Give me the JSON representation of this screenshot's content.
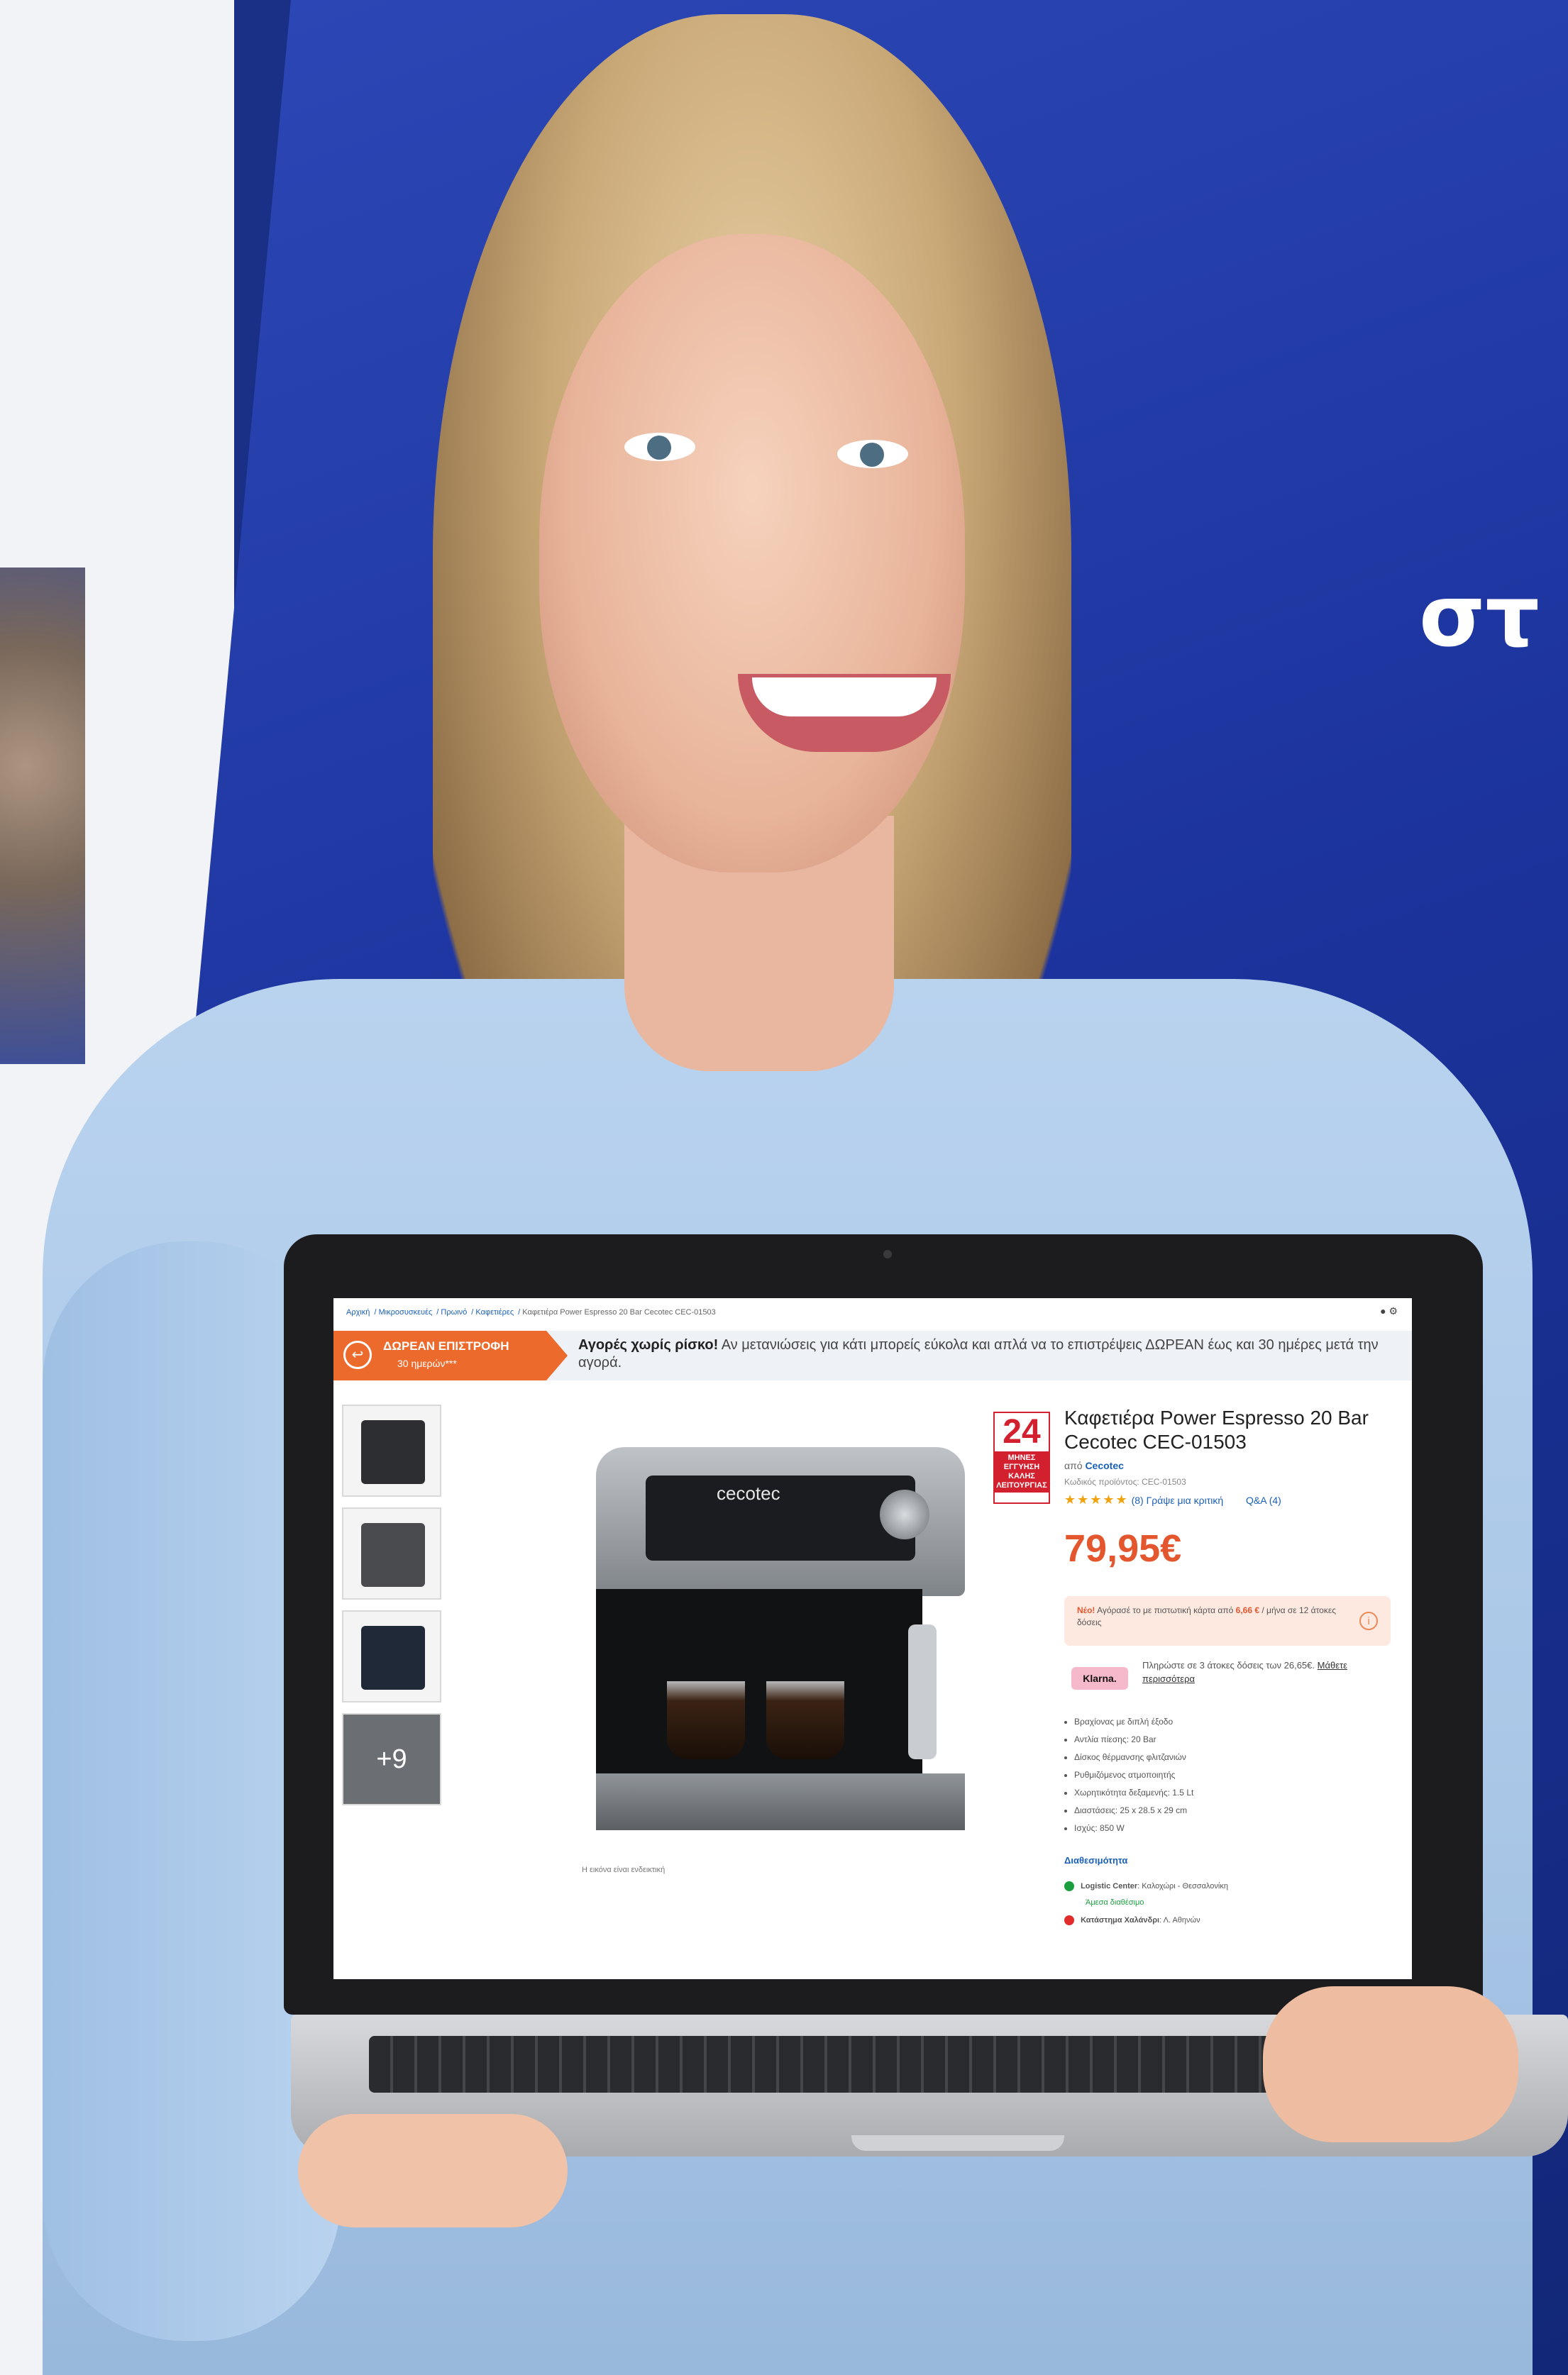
{
  "headline": "στ",
  "screen": {
    "breadcrumb": [
      "Αρχική",
      "Μικροσυσκευές",
      "Πρωινό",
      "Καφετιέρες",
      "Καφετιέρα Power Espresso 20 Bar Cecotec CEC-01503"
    ],
    "promo": {
      "badge_title": "ΔΩΡΕΑΝ ΕΠΙΣΤΡΟΦΗ",
      "badge_sub": "30 ημερών***",
      "bold": "Αγορές χωρίς ρίσκο!",
      "text": "Αν μετανιώσεις για κάτι μπορείς εύκολα και απλά να το επιστρέψεις ΔΩΡΕΑΝ έως και 30 ημέρες μετά την αγορά."
    },
    "gallery": {
      "more_label": "+9",
      "caption": "Η εικόνα είναι ενδεικτική"
    },
    "machine_brand": "cecotec",
    "warranty": {
      "number": "24",
      "text": "ΜΗΝΕΣ ΕΓΓΥΗΣΗ ΚΑΛΗΣ ΛΕΙΤΟΥΡΓΙΑΣ"
    },
    "product": {
      "title": "Καφετιέρα Power Espresso 20 Bar Cecotec CEC-01503",
      "by_prefix": "από",
      "brand": "Cecotec",
      "code_label": "Κωδικός προϊόντος:",
      "code": "CEC-01503",
      "stars": "★★★★★",
      "reviews": "(8) Γράψε μια κριτική",
      "qa": "Q&A (4)",
      "price": "79,95€"
    },
    "credit": {
      "new": "Νέο!",
      "text": "Αγόρασέ το με πιστωτική κάρτα από",
      "amount": "6,66 €",
      "installments": "/ μήνα σε 12 άτοκες δόσεις"
    },
    "klarna": {
      "logo": "Klarna.",
      "text": "Πληρώστε σε 3 άτοκες δόσεις των 26,65€.",
      "link": "Μάθετε περισσότερα"
    },
    "specs": [
      "Βραχίονας με διπλή έξοδο",
      "Αντλία πίεσης: 20 Bar",
      "Δίσκος θέρμανσης φλιτζανιών",
      "Ρυθμιζόμενος ατμοποιητής",
      "Χωρητικότητα δεξαμενής: 1.5 Lt",
      "Διαστάσεις: 25 x 28.5 x 29 cm",
      "Ισχύς: 850 W"
    ],
    "availability": {
      "title": "Διαθεσιμότητα",
      "store1": "Logistic Center",
      "store1_detail": "Καλοχώρι - Θεσσαλονίκη",
      "store1_status": "Άμεσα διαθέσιμο",
      "store2": "Κατάστημα Χαλάνδρι",
      "store2_detail": "Λ. Αθηνών"
    },
    "colors": {
      "accent": "#e4572e",
      "link": "#1b60b8",
      "promo": "#ec6a2c",
      "warranty": "#d2202f"
    }
  }
}
